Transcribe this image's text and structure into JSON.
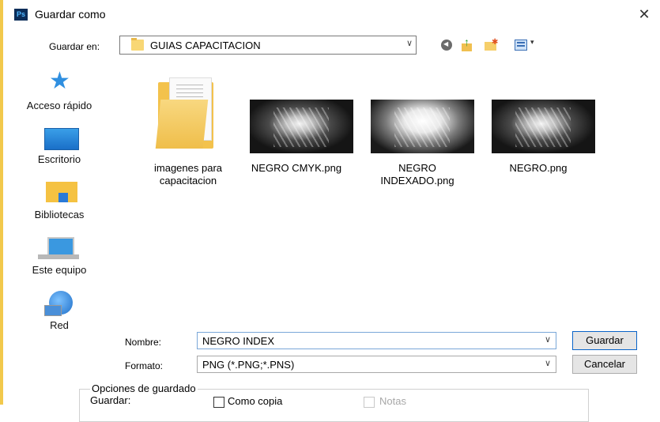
{
  "window": {
    "title": "Guardar como",
    "app_icon": "Ps"
  },
  "toolbar": {
    "save_in_label": "Guardar en:",
    "current_folder": "GUIAS CAPACITACION"
  },
  "sidebar": {
    "items": [
      {
        "label": "Acceso rápido",
        "icon": "star-icon"
      },
      {
        "label": "Escritorio",
        "icon": "desktop-icon"
      },
      {
        "label": "Bibliotecas",
        "icon": "libraries-icon"
      },
      {
        "label": "Este equipo",
        "icon": "computer-icon"
      },
      {
        "label": "Red",
        "icon": "network-icon"
      }
    ]
  },
  "files": [
    {
      "name_line1": "imagenes para",
      "name_line2": "capacitacion",
      "type": "folder"
    },
    {
      "name_line1": "NEGRO CMYK.png",
      "name_line2": "",
      "type": "image"
    },
    {
      "name_line1": "NEGRO",
      "name_line2": "INDEXADO.png",
      "type": "image"
    },
    {
      "name_line1": "NEGRO.png",
      "name_line2": "",
      "type": "image"
    }
  ],
  "form": {
    "name_label": "Nombre:",
    "name_value": "NEGRO INDEX",
    "format_label": "Formato:",
    "format_value": "PNG (*.PNG;*.PNS)"
  },
  "buttons": {
    "save": "Guardar",
    "cancel": "Cancelar"
  },
  "options": {
    "group_title": "Opciones de guardado",
    "save_label": "Guardar:",
    "as_copy": "Como copia",
    "notes": "Notas"
  }
}
